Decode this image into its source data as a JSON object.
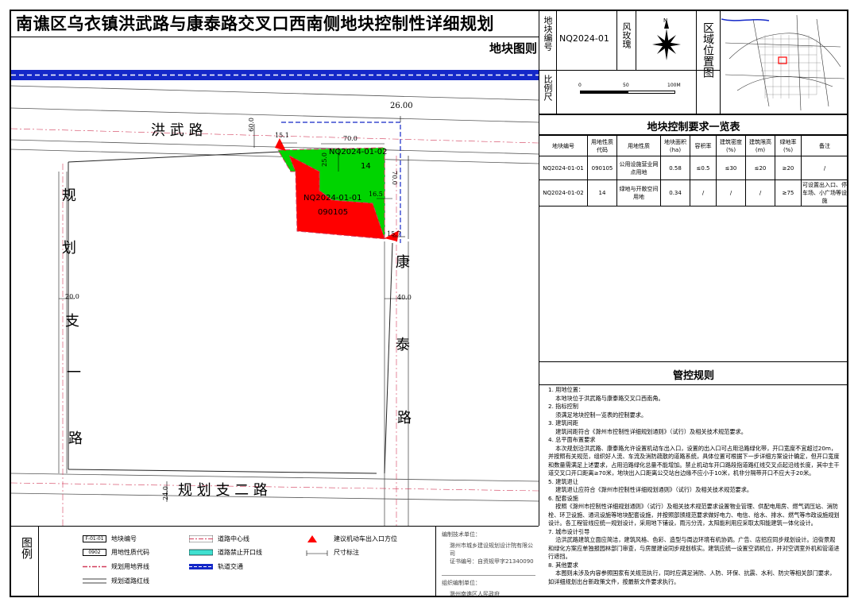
{
  "header": {
    "title": "南谯区乌衣镇洪武路与康泰路交叉口西南侧地块控制性详细规划",
    "subtitle": "地块图则"
  },
  "info": {
    "parcel_label": "地块编号",
    "parcel_value": "NQ2024-01",
    "rose_label": "风玫瑰",
    "scale_label": "比例尺",
    "scale_ticks": [
      "0",
      "50",
      "100M"
    ],
    "location_label": "区域位置图"
  },
  "control_table": {
    "title": "地块控制要求一览表",
    "headers": [
      "地块编号",
      "用地性质代码",
      "用地性质",
      "地块面积(ha)",
      "容积率",
      "建筑密度(%)",
      "建筑限高(m)",
      "绿地率(%)",
      "备注"
    ],
    "rows": [
      [
        "NQ2024-01-01",
        "090105",
        "公用设施营业网点用地",
        "0.58",
        "≤0.5",
        "≤30",
        "≤20",
        "≥20",
        "/"
      ],
      [
        "NQ2024-01-02",
        "14",
        "绿地与开敞空间用地",
        "0.34",
        "/",
        "/",
        "/",
        "≥75",
        "可设置出入口、停车场、小广场等设施"
      ]
    ]
  },
  "rules": {
    "title": "管控规则",
    "lines": [
      "1. 用地位置：",
      "    本地块位于洪武路与康泰路交叉口西南角。",
      "2. 指标控制",
      "    须满足地块控制一览表的控制要求。",
      "3. 建筑间距",
      "    建筑间距符合《滁州市控制性详细规划通则》（试行）及相关技术规范要求。",
      "4. 总平面布置要求",
      "    本次规划沿洪武路、康泰路允许设置机动车出入口，设置的出入口可占用沿路绿化带，开口宽度不宜超过20m，并按照有关规范，组织好人流、车流及消防疏散的道路系统，具体位置可根据下一步详细方案设计确定，但开口宽度和数量需满足上述要求，占用沿路绿化总量不能增加。禁止机动车开口路段指道路红线交叉点起沿线长度，其中主干道交叉口开口距离≥70米，地块出入口距离公交站台边缘不应小于10米，机非分隔带开口不应大于20米。",
      "5. 建筑退让",
      "    建筑退让应符合《滁州市控制性详细规划通则》（试行）及相关技术规范要求。",
      "6. 配套设施",
      "    按照《滁州市控制性详细规划通则》（试行）及相关技术规范要求设置物业管理、供配电用房、燃气调压站、消防栓、环卫设施、通讯设施等地块配套设施，并按照部颁规范要求做好电力、电信、给水、排水、燃气等市政设施规划设计。各工程管线应统一规划设计，采用地下铺设，雨污分流，太阳能利用应采取太阳能建筑一体化设计。",
      "7. 城市设计引导",
      "    沿洪武路建筑立面应简洁，建筑风格、色彩、造型与周边环境有机协调。广告、店招应同步规划设计。沿街景观和绿化方案应单独报园林部门审查，与房屋建设同步规划核实。建筑应统一设置空调机位，并对空调室外机和管道进行遮挡。",
      "8. 其他要求",
      "    本图则未涉及内容参照国家有关规范执行，同时应满足消防、人防、环保、抗震、水利、防灾等相关部门要求，如详细规划出台新政策文件，按最新文件要求执行。"
    ]
  },
  "map": {
    "roads": {
      "hongwu": "洪 武 路",
      "kangtai": [
        "康",
        "泰",
        "路"
      ],
      "zhi1": [
        "规",
        "划",
        "支",
        "一",
        "路"
      ],
      "zhi2": "规 划 支 二 路"
    },
    "dims": {
      "d2600": "26.00",
      "d600": "60.0",
      "d151": "15.1",
      "d700a": "70.0",
      "d250": "25.0",
      "d700b": "70.0",
      "d165": "16.5",
      "d157": "15.7",
      "d400": "40.0",
      "d200": "20.0",
      "d240": "24.0"
    },
    "parcel_green": {
      "code": "NQ2024-01-02",
      "use": "14"
    },
    "parcel_red": {
      "code": "NQ2024-01-01",
      "use": "090105"
    }
  },
  "legend": {
    "label": "图例",
    "items": [
      {
        "symbol": "F-01-01",
        "text": "地块编号"
      },
      {
        "symbol": "0902",
        "text": "用地性质代码"
      },
      {
        "symbol": "",
        "text": "规划用地界线"
      },
      {
        "symbol": "",
        "text": "规划道路红线"
      },
      {
        "symbol": "",
        "text": "道路中心线"
      },
      {
        "symbol": "",
        "text": "道路禁止开口线"
      },
      {
        "symbol": "",
        "text": "轨道交通"
      },
      {
        "symbol": "",
        "text": "建议机动车出入口方位"
      },
      {
        "symbol": "",
        "text": "尺寸标注"
      }
    ]
  },
  "org": {
    "tech_label": "编制技术单位：",
    "tech_unit": "滁州市城乡建设规划设计院有限公司",
    "cert": "证书编号：自资规甲字21340090",
    "org_label": "组织编制单位：",
    "org_unit": "滁州南谯区人民政府"
  },
  "colors": {
    "red": "#ff0000",
    "green": "#00d400",
    "rail": "#1428c8",
    "line_red": "#d23c5a"
  }
}
